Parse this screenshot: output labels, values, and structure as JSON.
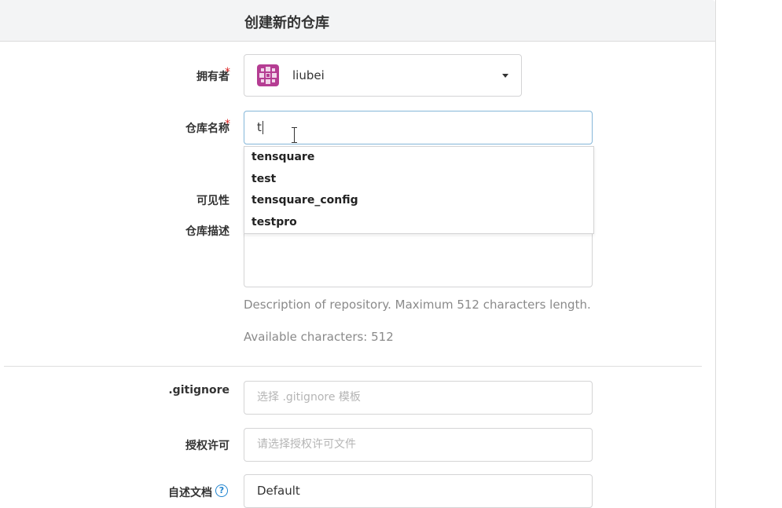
{
  "page": {
    "title": "创建新的仓库"
  },
  "form": {
    "owner": {
      "label": "拥有者",
      "required_mark": "*",
      "value": "liubei"
    },
    "repo_name": {
      "label": "仓库名称",
      "required_mark": "*",
      "value": "t"
    },
    "autocomplete": {
      "items": [
        "tensquare",
        "test",
        "tensquare_config",
        "testpro"
      ]
    },
    "visibility": {
      "label": "可见性"
    },
    "description": {
      "label": "仓库描述",
      "help": "Description of repository. Maximum 512 characters length.",
      "available": "Available characters: 512"
    },
    "gitignore": {
      "label": ".gitignore",
      "placeholder": "选择 .gitignore 模板"
    },
    "license": {
      "label": "授权许可",
      "placeholder": "请选择授权许可文件"
    },
    "readme": {
      "label": "自述文档",
      "help_icon": "question-circle-icon",
      "value": "Default"
    }
  },
  "colors": {
    "required": "#db2828",
    "focus_border": "#85b7d9",
    "avatar": "#b53d93",
    "help_icon": "#2185d0"
  }
}
